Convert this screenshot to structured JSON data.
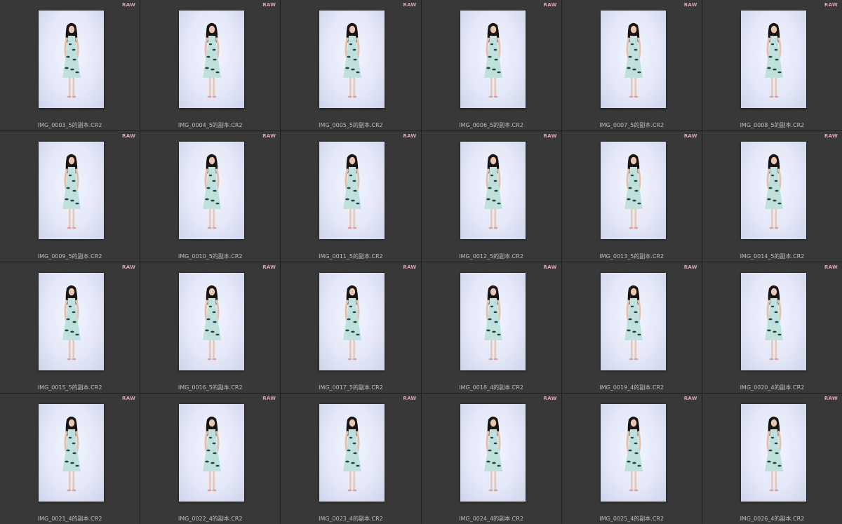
{
  "grid": {
    "badge_label": "RAW",
    "badge_color": "#d9a3b5",
    "cell_background": "#383838",
    "icons": {
      "photo": "thumbnail-photo-icon"
    },
    "items": [
      {
        "filename": "IMG_0003_5的副本.CR2",
        "badge": "RAW"
      },
      {
        "filename": "IMG_0004_5的副本.CR2",
        "badge": "RAW"
      },
      {
        "filename": "IMG_0005_5的副本.CR2",
        "badge": "RAW"
      },
      {
        "filename": "IMG_0006_5的副本.CR2",
        "badge": "RAW"
      },
      {
        "filename": "IMG_0007_5的副本.CR2",
        "badge": "RAW"
      },
      {
        "filename": "IMG_0008_5的副本.CR2",
        "badge": "RAW"
      },
      {
        "filename": "IMG_0009_5的副本.CR2",
        "badge": "RAW"
      },
      {
        "filename": "IMG_0010_5的副本.CR2",
        "badge": "RAW"
      },
      {
        "filename": "IMG_0011_5的副本.CR2",
        "badge": "RAW"
      },
      {
        "filename": "IMG_0012_5的副本.CR2",
        "badge": "RAW"
      },
      {
        "filename": "IMG_0013_5的副本.CR2",
        "badge": "RAW"
      },
      {
        "filename": "IMG_0014_5的副本.CR2",
        "badge": "RAW"
      },
      {
        "filename": "IMG_0015_5的副本.CR2",
        "badge": "RAW"
      },
      {
        "filename": "IMG_0016_5的副本.CR2",
        "badge": "RAW"
      },
      {
        "filename": "IMG_0017_5的副本.CR2",
        "badge": "RAW"
      },
      {
        "filename": "IMG_0018_4的副本.CR2",
        "badge": "RAW"
      },
      {
        "filename": "IMG_0019_4的副本.CR2",
        "badge": "RAW"
      },
      {
        "filename": "IMG_0020_4的副本.CR2",
        "badge": "RAW"
      },
      {
        "filename": "IMG_0021_4的副本.CR2",
        "badge": "RAW"
      },
      {
        "filename": "IMG_0022_4的副本.CR2",
        "badge": "RAW"
      },
      {
        "filename": "IMG_0023_4的副本.CR2",
        "badge": "RAW"
      },
      {
        "filename": "IMG_0024_4的副本.CR2",
        "badge": "RAW"
      },
      {
        "filename": "IMG_0025_4的副本.CR2",
        "badge": "RAW"
      },
      {
        "filename": "IMG_0026_4的副本.CR2",
        "badge": "RAW"
      }
    ]
  }
}
